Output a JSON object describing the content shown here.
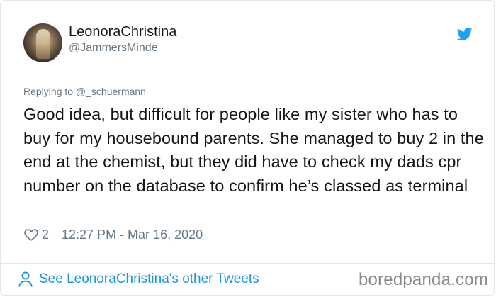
{
  "user": {
    "display_name": "LeonoraChristina",
    "handle": "@JammersMinde"
  },
  "tweet": {
    "replying_to": "Replying to @_schuermann",
    "text": "Good idea, but difficult for people like my sister who has to buy for my housebound parents. She managed to buy 2 in the end at the chemist, but they did have to check my dads cpr number on the database to confirm he’s classed as terminal",
    "likes": "2",
    "timestamp": "12:27 PM - Mar 16, 2020"
  },
  "footer": {
    "see_more_label": "See LeonoraChristina's other Tweets"
  },
  "watermark": "boredpanda.com",
  "icons": {
    "bird": "twitter-bird-icon",
    "heart": "heart-outline-icon",
    "person": "person-icon"
  },
  "colors": {
    "twitter_blue": "#1da1f2",
    "link_blue": "#1b95e0",
    "secondary_text": "#657786",
    "primary_text": "#14171a",
    "border": "#e1e8ed"
  }
}
